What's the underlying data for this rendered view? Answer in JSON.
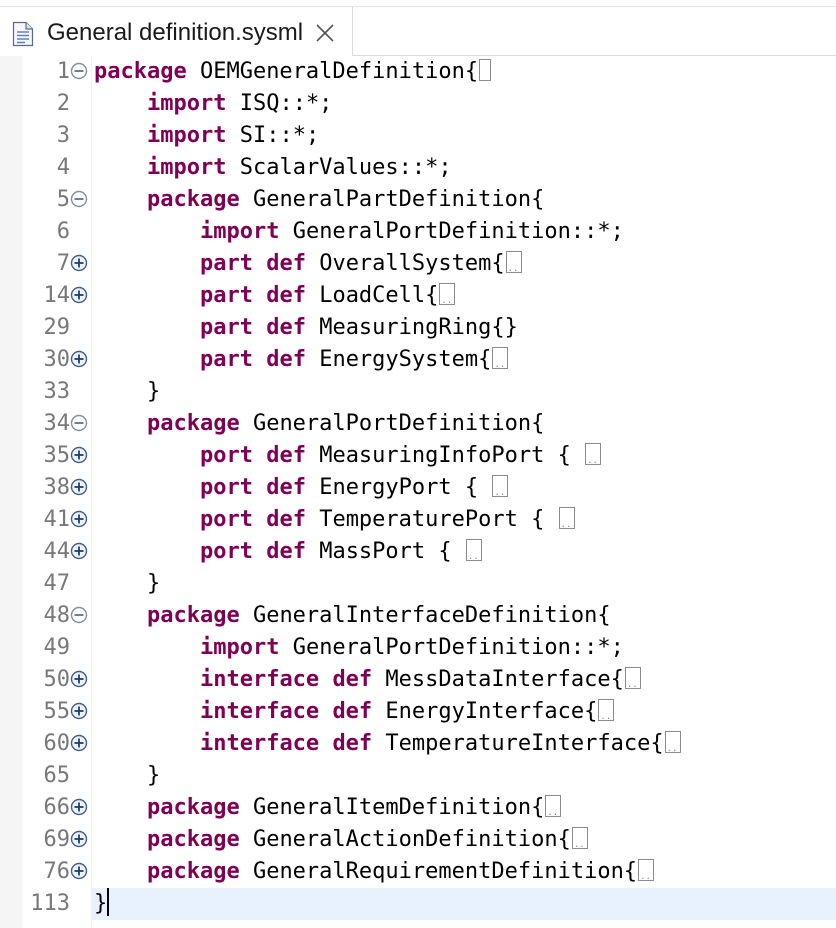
{
  "tab": {
    "title": "General definition.sysml",
    "file_icon": "text-file-icon",
    "close_icon": "close-icon"
  },
  "colors": {
    "keyword": "#7f0055",
    "line_number": "#787878",
    "current_line": "#e8f2fe"
  },
  "lines": [
    {
      "num": "1",
      "fold": "collapse",
      "tokens": [
        {
          "t": "package",
          "k": true
        },
        {
          "t": " OEMGeneralDefinition{"
        }
      ],
      "tail": "box"
    },
    {
      "num": "2",
      "fold": null,
      "tokens": [
        {
          "t": "    "
        },
        {
          "t": "import",
          "k": true
        },
        {
          "t": " ISQ::*;"
        }
      ]
    },
    {
      "num": "3",
      "fold": null,
      "tokens": [
        {
          "t": "    "
        },
        {
          "t": "import",
          "k": true
        },
        {
          "t": " SI::*;"
        }
      ]
    },
    {
      "num": "4",
      "fold": null,
      "tokens": [
        {
          "t": "    "
        },
        {
          "t": "import",
          "k": true
        },
        {
          "t": " ScalarValues::*;"
        }
      ]
    },
    {
      "num": "5",
      "fold": "collapse",
      "tokens": [
        {
          "t": "    "
        },
        {
          "t": "package",
          "k": true
        },
        {
          "t": " GeneralPartDefinition{"
        }
      ]
    },
    {
      "num": "6",
      "fold": null,
      "tokens": [
        {
          "t": "        "
        },
        {
          "t": "import",
          "k": true
        },
        {
          "t": " GeneralPortDefinition::*;"
        }
      ]
    },
    {
      "num": "7",
      "fold": "expand",
      "tokens": [
        {
          "t": "        "
        },
        {
          "t": "part",
          "k": true
        },
        {
          "t": " "
        },
        {
          "t": "def",
          "k": true
        },
        {
          "t": " OverallSystem{"
        }
      ],
      "tail": "ellipsis"
    },
    {
      "num": "14",
      "fold": "expand",
      "tokens": [
        {
          "t": "        "
        },
        {
          "t": "part",
          "k": true
        },
        {
          "t": " "
        },
        {
          "t": "def",
          "k": true
        },
        {
          "t": " LoadCell{"
        }
      ],
      "tail": "ellipsis"
    },
    {
      "num": "29",
      "fold": null,
      "tokens": [
        {
          "t": "        "
        },
        {
          "t": "part",
          "k": true
        },
        {
          "t": " "
        },
        {
          "t": "def",
          "k": true
        },
        {
          "t": " MeasuringRing{}"
        }
      ]
    },
    {
      "num": "30",
      "fold": "expand",
      "tokens": [
        {
          "t": "        "
        },
        {
          "t": "part",
          "k": true
        },
        {
          "t": " "
        },
        {
          "t": "def",
          "k": true
        },
        {
          "t": " EnergySystem{"
        }
      ],
      "tail": "ellipsis"
    },
    {
      "num": "33",
      "fold": null,
      "tokens": [
        {
          "t": "    }"
        }
      ]
    },
    {
      "num": "34",
      "fold": "collapse",
      "tokens": [
        {
          "t": "    "
        },
        {
          "t": "package",
          "k": true
        },
        {
          "t": " GeneralPortDefinition{"
        }
      ]
    },
    {
      "num": "35",
      "fold": "expand",
      "tokens": [
        {
          "t": "        "
        },
        {
          "t": "port",
          "k": true
        },
        {
          "t": " "
        },
        {
          "t": "def",
          "k": true
        },
        {
          "t": " MeasuringInfoPort { "
        }
      ],
      "tail": "ellipsis"
    },
    {
      "num": "38",
      "fold": "expand",
      "tokens": [
        {
          "t": "        "
        },
        {
          "t": "port",
          "k": true
        },
        {
          "t": " "
        },
        {
          "t": "def",
          "k": true
        },
        {
          "t": " EnergyPort { "
        }
      ],
      "tail": "ellipsis"
    },
    {
      "num": "41",
      "fold": "expand",
      "tokens": [
        {
          "t": "        "
        },
        {
          "t": "port",
          "k": true
        },
        {
          "t": " "
        },
        {
          "t": "def",
          "k": true
        },
        {
          "t": " TemperaturePort { "
        }
      ],
      "tail": "ellipsis"
    },
    {
      "num": "44",
      "fold": "expand",
      "tokens": [
        {
          "t": "        "
        },
        {
          "t": "port",
          "k": true
        },
        {
          "t": " "
        },
        {
          "t": "def",
          "k": true
        },
        {
          "t": " MassPort { "
        }
      ],
      "tail": "ellipsis"
    },
    {
      "num": "47",
      "fold": null,
      "tokens": [
        {
          "t": "    }"
        }
      ]
    },
    {
      "num": "48",
      "fold": "collapse",
      "tokens": [
        {
          "t": "    "
        },
        {
          "t": "package",
          "k": true
        },
        {
          "t": " GeneralInterfaceDefinition{"
        }
      ]
    },
    {
      "num": "49",
      "fold": null,
      "tokens": [
        {
          "t": "        "
        },
        {
          "t": "import",
          "k": true
        },
        {
          "t": " GeneralPortDefinition::*;"
        }
      ]
    },
    {
      "num": "50",
      "fold": "expand",
      "tokens": [
        {
          "t": "        "
        },
        {
          "t": "interface",
          "k": true
        },
        {
          "t": " "
        },
        {
          "t": "def",
          "k": true
        },
        {
          "t": " MessDataInterface{"
        }
      ],
      "tail": "ellipsis"
    },
    {
      "num": "55",
      "fold": "expand",
      "tokens": [
        {
          "t": "        "
        },
        {
          "t": "interface",
          "k": true
        },
        {
          "t": " "
        },
        {
          "t": "def",
          "k": true
        },
        {
          "t": " EnergyInterface{"
        }
      ],
      "tail": "ellipsis"
    },
    {
      "num": "60",
      "fold": "expand",
      "tokens": [
        {
          "t": "        "
        },
        {
          "t": "interface",
          "k": true
        },
        {
          "t": " "
        },
        {
          "t": "def",
          "k": true
        },
        {
          "t": " TemperatureInterface{"
        }
      ],
      "tail": "ellipsis"
    },
    {
      "num": "65",
      "fold": null,
      "tokens": [
        {
          "t": "    }"
        }
      ]
    },
    {
      "num": "66",
      "fold": "expand",
      "tokens": [
        {
          "t": "    "
        },
        {
          "t": "package",
          "k": true
        },
        {
          "t": " GeneralItemDefinition{"
        }
      ],
      "tail": "ellipsis"
    },
    {
      "num": "69",
      "fold": "expand",
      "tokens": [
        {
          "t": "    "
        },
        {
          "t": "package",
          "k": true
        },
        {
          "t": " GeneralActionDefinition{"
        }
      ],
      "tail": "ellipsis"
    },
    {
      "num": "76",
      "fold": "expand",
      "tokens": [
        {
          "t": "    "
        },
        {
          "t": "package",
          "k": true
        },
        {
          "t": " GeneralRequirementDefinition{"
        }
      ],
      "tail": "ellipsis"
    },
    {
      "num": "113",
      "fold": null,
      "tokens": [
        {
          "t": "}"
        }
      ],
      "tail": "caret",
      "current": true
    }
  ]
}
